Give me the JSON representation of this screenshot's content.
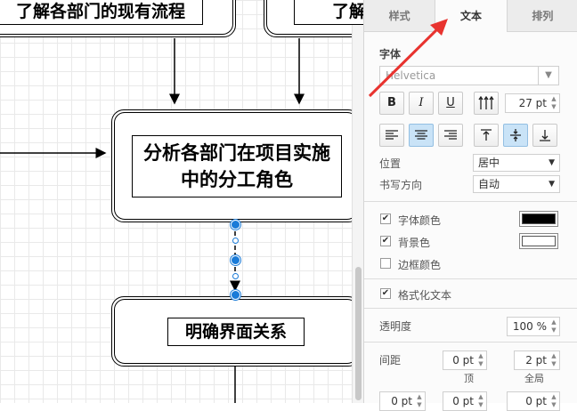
{
  "canvas": {
    "top_left_box": "了解各部门的现有流程",
    "top_right_box": "了解",
    "middle_box": "分析各部门在项目实施中的分工角色",
    "bottom_box": "明确界面关系"
  },
  "panel": {
    "tabs": [
      {
        "label": "样式",
        "active": false
      },
      {
        "label": "文本",
        "active": true
      },
      {
        "label": "排列",
        "active": false
      }
    ],
    "font_section_label": "字体",
    "font_name": "Helvetica",
    "style_buttons": {
      "bold": "B",
      "italic": "I",
      "underline": "U"
    },
    "font_size": "27 pt",
    "position_label": "位置",
    "position_value": "居中",
    "direction_label": "书写方向",
    "direction_value": "自动",
    "font_color_label": "字体颜色",
    "font_color_checked": true,
    "font_color_value": "#000000",
    "background_label": "背景色",
    "background_checked": true,
    "background_value": "#ffffff",
    "border_color_label": "边框颜色",
    "border_color_checked": false,
    "formatted_text_label": "格式化文本",
    "formatted_text_checked": true,
    "opacity_label": "透明度",
    "opacity_value": "100 %",
    "spacing_label": "间距",
    "spacing_top_value": "0 pt",
    "spacing_top_label": "顶",
    "spacing_global_value": "2 pt",
    "spacing_global_label": "全局",
    "row3_values": [
      "0 pt",
      "0 pt",
      "0 pt"
    ]
  },
  "colors": {
    "accent": "#1a7bd8",
    "annotation_arrow": "#e8332f"
  }
}
